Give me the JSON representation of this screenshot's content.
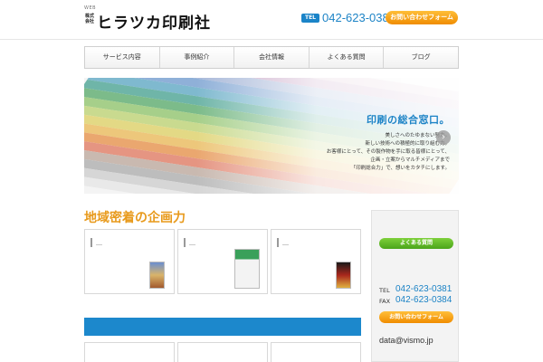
{
  "header": {
    "small_label": "WEB",
    "logo_prefix": "株式会社",
    "logo_name": "ヒラツカ印刷社",
    "tel_badge": "TEL",
    "tel_number": "042-623-0381",
    "contact_button": "お問い合わせフォーム"
  },
  "nav": {
    "items": [
      {
        "label": "サービス内容"
      },
      {
        "label": "事例紹介"
      },
      {
        "label": "会社情報"
      },
      {
        "label": "よくある質問"
      },
      {
        "label": "ブログ"
      }
    ]
  },
  "hero": {
    "title": "印刷の総合窓口。",
    "lines": [
      "美しさへのたゆまない努力。",
      "新しい技術への積極的に取り組む力。",
      "お客様にとって、その製作物を手に取る皆様にとって、",
      "企画・立案からマルチメディアまで",
      "「印刷総合力」で、想いをカタチにします。"
    ],
    "arrow": "›"
  },
  "main": {
    "section_title": "地域密着の企画力",
    "cards": [
      {
        "label": "＿"
      },
      {
        "label": "＿"
      },
      {
        "label": "＿"
      }
    ]
  },
  "sidebar": {
    "faq_button": "よくある質問",
    "tel_label": "TEL",
    "tel_number": "042-623-0381",
    "fax_label": "FAX",
    "fax_number": "042-623-0384",
    "contact_button": "お問い合わせフォーム",
    "email": "data@vismo.jp"
  },
  "colors": {
    "accent_blue": "#1c83c6",
    "accent_orange": "#f08c00",
    "accent_green": "#4ba51a",
    "section_title": "#e89a1c"
  }
}
